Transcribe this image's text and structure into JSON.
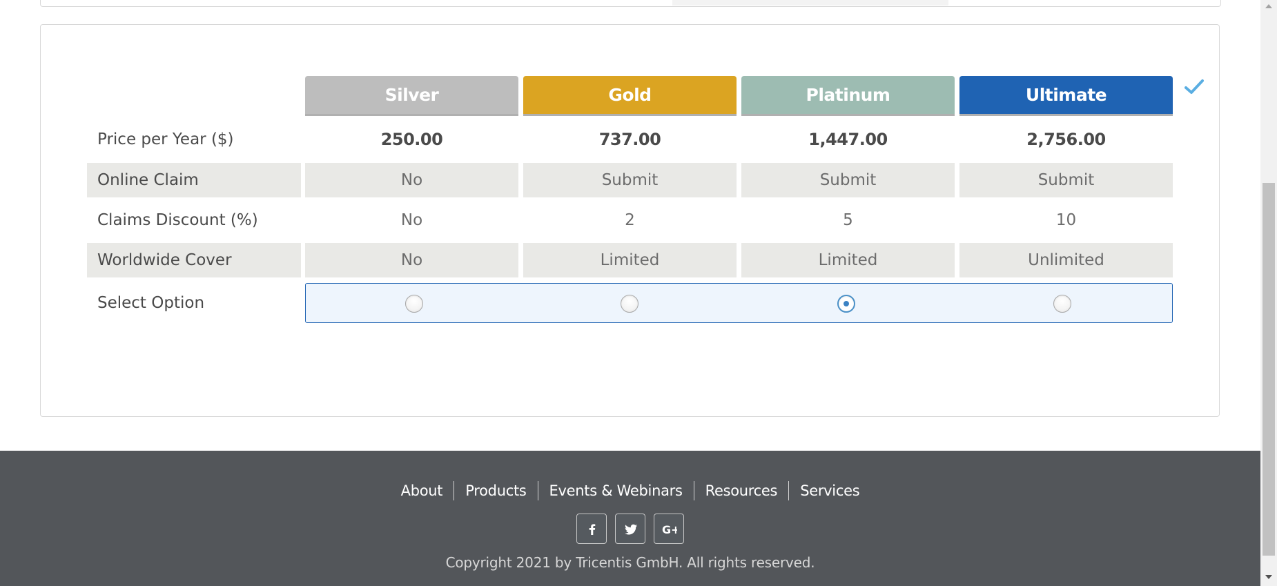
{
  "plans": [
    "Silver",
    "Gold",
    "Platinum",
    "Ultimate"
  ],
  "rows": [
    {
      "label": "Price per Year ($)",
      "values": [
        "250.00",
        "737.00",
        "1,447.00",
        "2,756.00"
      ]
    },
    {
      "label": "Online Claim",
      "values": [
        "No",
        "Submit",
        "Submit",
        "Submit"
      ]
    },
    {
      "label": "Claims Discount (%)",
      "values": [
        "No",
        "2",
        "5",
        "10"
      ]
    },
    {
      "label": "Worldwide Cover",
      "values": [
        "No",
        "Limited",
        "Limited",
        "Unlimited"
      ]
    }
  ],
  "select": {
    "label": "Select Option",
    "selected": "Platinum"
  },
  "icons": {
    "complete": "check-icon",
    "social": [
      "facebook-icon",
      "twitter-icon",
      "google-plus-icon"
    ]
  },
  "footer": {
    "links": [
      "About",
      "Products",
      "Events & Webinars",
      "Resources",
      "Services"
    ],
    "copyright": "Copyright 2021 by Tricentis GmbH. All rights reserved."
  },
  "colors": {
    "silver": "#bdbdbd",
    "gold": "#dba422",
    "platinum": "#9dbcb2",
    "ultimate": "#1f63b3",
    "footer": "#53565a"
  }
}
